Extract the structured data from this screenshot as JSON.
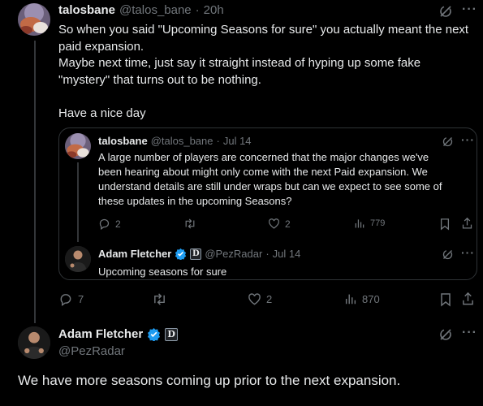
{
  "main_tweet": {
    "display_name": "talosbane",
    "handle": "@talos_bane",
    "separator": "·",
    "time": "20h",
    "text_lines": [
      "So when you said \"Upcoming Seasons for sure\" you actually meant the next",
      "paid expansion.",
      "Maybe next time, just say it straight instead of hyping up some fake",
      "\"mystery\" that turns out to be nothing.",
      "",
      "Have a nice day"
    ],
    "stats": {
      "replies": "7",
      "retweets": "",
      "likes": "2",
      "views": "870"
    }
  },
  "quoted_tweet": {
    "display_name": "talosbane",
    "handle": "@talos_bane",
    "separator": "·",
    "time": "Jul 14",
    "text_lines": [
      "A large number of players are concerned that the major changes we've",
      "been hearing about might only come with the next Paid expansion. We",
      "understand details are still under wraps but can we expect to see some of",
      "these updates in the upcoming Seasons?"
    ],
    "stats": {
      "replies": "2",
      "retweets": "",
      "likes": "2",
      "views": "779"
    }
  },
  "quoted_reply": {
    "display_name": "Adam Fletcher",
    "handle": "@PezRadar",
    "separator": "·",
    "time": "Jul 14",
    "badge_letter": "D",
    "text": "Upcoming seasons for sure"
  },
  "reply_tweet": {
    "display_name": "Adam Fletcher",
    "handle": "@PezRadar",
    "badge_letter": "D",
    "text": "We have more seasons coming up prior to the next expansion."
  },
  "colors": {
    "background": "#000000",
    "text": "#e7e9ea",
    "muted": "#71767b",
    "verified": "#1d9bf0",
    "border": "#2f3336"
  },
  "icons": [
    "grok-icon",
    "more-icon",
    "reply-icon",
    "retweet-icon",
    "like-icon",
    "views-icon",
    "bookmark-icon",
    "share-icon",
    "verified-icon"
  ]
}
